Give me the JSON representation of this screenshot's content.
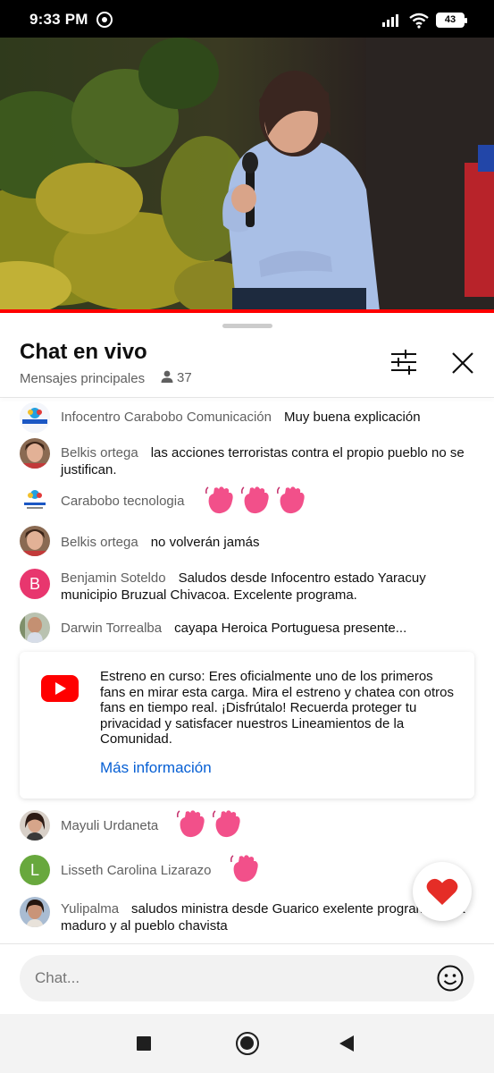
{
  "status_bar": {
    "time": "9:33 PM",
    "battery": "43",
    "icons": [
      "whatsapp-icon",
      "signal-icon",
      "wifi-icon",
      "battery-icon"
    ]
  },
  "video": {
    "progress": 1.0,
    "progress_color": "#ff0000"
  },
  "chat": {
    "title": "Chat en vivo",
    "subtitle": "Mensajes principales",
    "viewer_count": "37",
    "icons": [
      "filter-icon",
      "close-icon",
      "person-icon"
    ]
  },
  "messages": [
    {
      "author": "Infocentro Carabobo Comunicación",
      "text": "Muy buena explicación",
      "avatar": "infocentro-logo"
    },
    {
      "author": "Belkis ortega",
      "text": "las acciones terroristas contra el propio pueblo no se justifican.",
      "avatar": "photo"
    },
    {
      "author": "Carabobo tecnologia",
      "text": "",
      "emoji_count": 3,
      "avatar": "infocentro-logo"
    },
    {
      "author": "Belkis ortega",
      "text": "no volverán jamás",
      "avatar": "photo"
    },
    {
      "author": "Benjamin Soteldo",
      "text": "Saludos desde Infocentro estado Yaracuy municipio Bruzual Chivacoa. Excelente programa.",
      "avatar_letter": "B",
      "avatar_color": "#e8366e"
    },
    {
      "author": "Darwin Torrealba",
      "text": "cayapa Heroica Portuguesa presente...",
      "avatar": "photo"
    },
    {
      "author": "Mayuli Urdaneta",
      "text": "",
      "emoji_count": 2,
      "avatar": "photo"
    },
    {
      "author": "Lisseth Carolina Lizarazo",
      "text": "",
      "emoji_count": 1,
      "avatar_letter": "L",
      "avatar_color": "#68a83d"
    },
    {
      "author": "Yulipalma",
      "text": "saludos ministra desde Guarico exelente programa para maduro y al pueblo chavista",
      "avatar": "photo"
    }
  ],
  "notice": {
    "text": "Estreno en curso: Eres oficialmente uno de los primeros fans en mirar esta carga. Mira el estreno y chatea con otros fans en tiempo real. ¡Disfrútalo! Recuerda proteger tu privacidad y satisfacer nuestros Lineamientos de la Comunidad.",
    "link": "Más información",
    "icon": "youtube-logo-icon"
  },
  "input": {
    "placeholder": "Chat..."
  },
  "colors": {
    "accent_link": "#065fd4",
    "heart": "#e52d27",
    "wave_emoji": "#f2508a"
  }
}
